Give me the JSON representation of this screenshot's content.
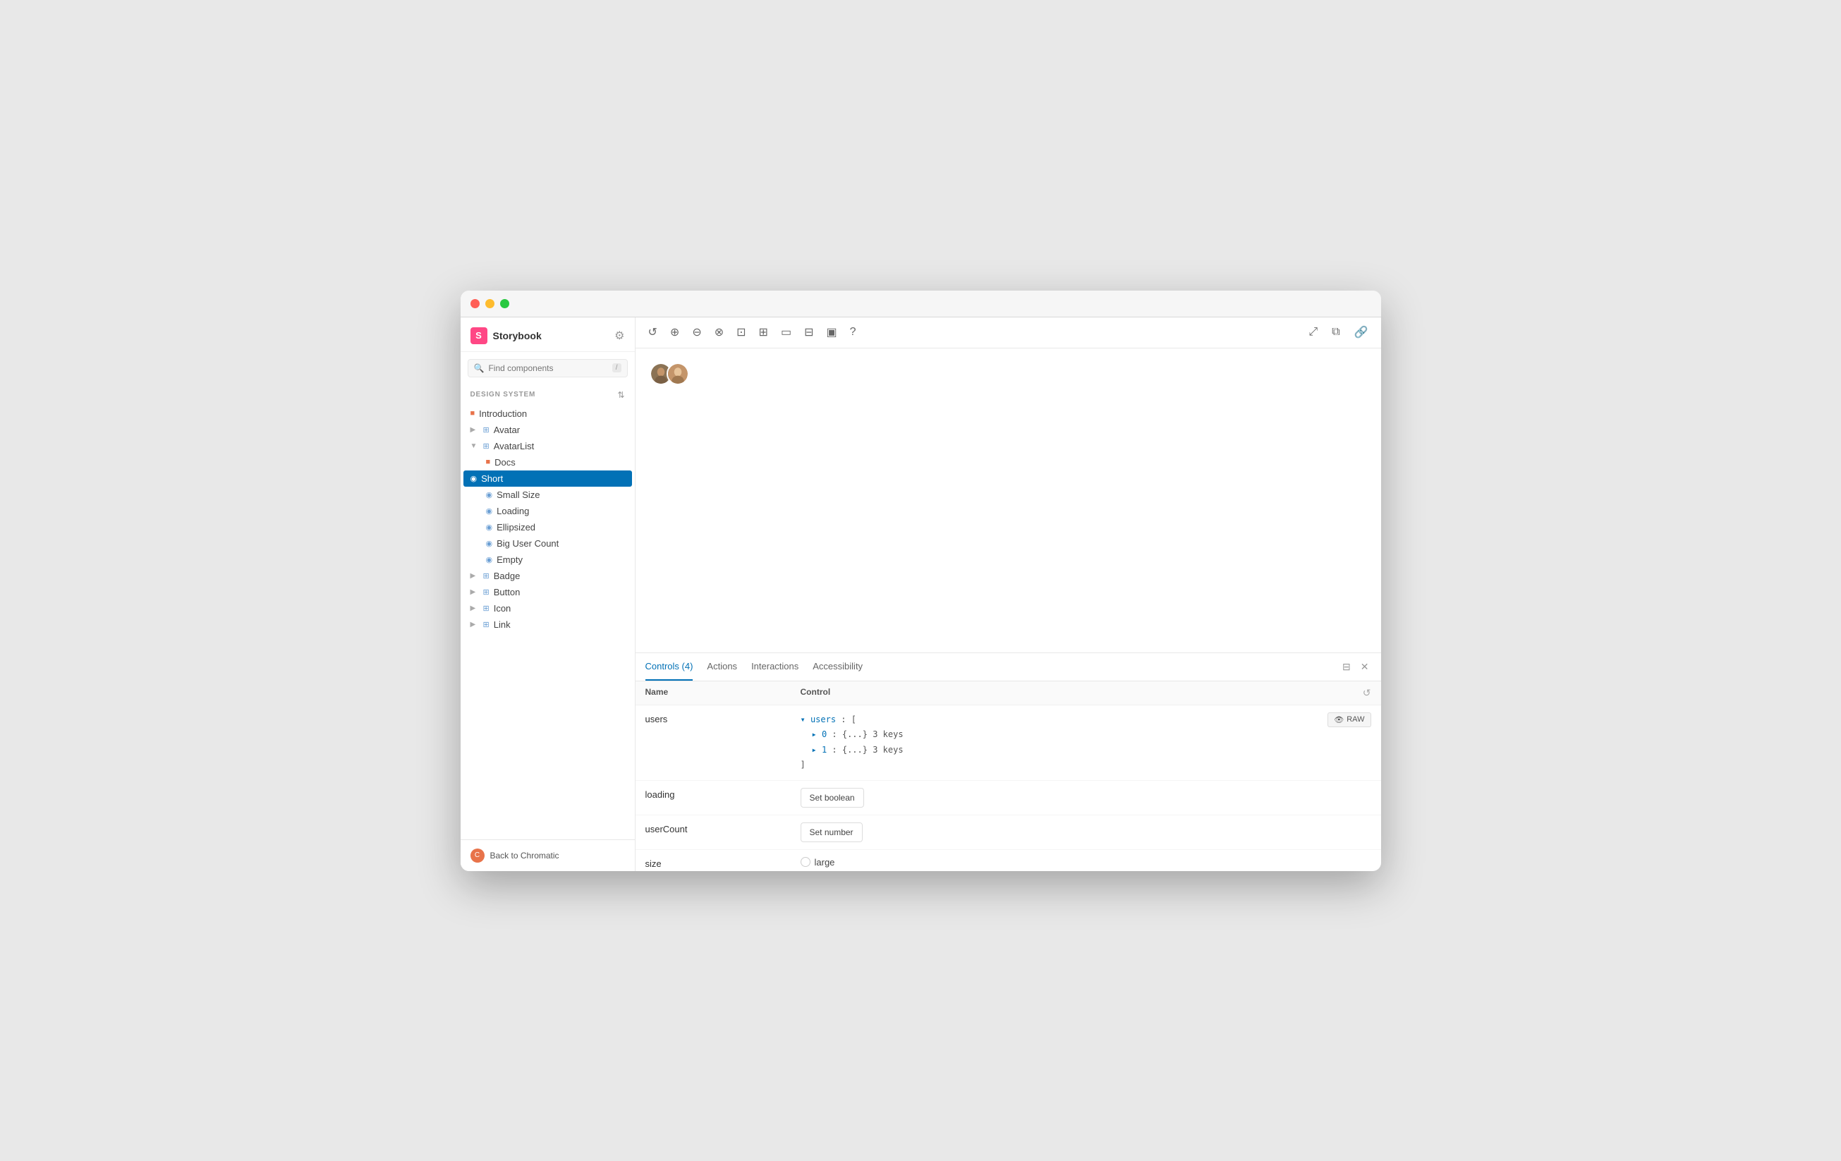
{
  "window": {
    "title": "Storybook"
  },
  "sidebar": {
    "logo": "S",
    "app_name": "Storybook",
    "search_placeholder": "Find components",
    "search_shortcut": "/",
    "section_title": "DESIGN SYSTEM",
    "nav_items": [
      {
        "id": "introduction",
        "label": "Introduction",
        "icon": "doc",
        "indent": 0,
        "type": "doc"
      },
      {
        "id": "avatar",
        "label": "Avatar",
        "icon": "component",
        "indent": 0,
        "type": "component",
        "expanded": false
      },
      {
        "id": "avatarlist",
        "label": "AvatarList",
        "icon": "component",
        "indent": 0,
        "type": "component",
        "expanded": true
      },
      {
        "id": "avatarlist-docs",
        "label": "Docs",
        "icon": "doc",
        "indent": 1,
        "type": "doc"
      },
      {
        "id": "avatarlist-short",
        "label": "Short",
        "icon": "story",
        "indent": 1,
        "type": "story",
        "active": true
      },
      {
        "id": "avatarlist-smallsize",
        "label": "Small Size",
        "icon": "story",
        "indent": 1,
        "type": "story"
      },
      {
        "id": "avatarlist-loading",
        "label": "Loading",
        "icon": "story",
        "indent": 1,
        "type": "story"
      },
      {
        "id": "avatarlist-ellipsized",
        "label": "Ellipsized",
        "icon": "story",
        "indent": 1,
        "type": "story"
      },
      {
        "id": "avatarlist-bigusercount",
        "label": "Big User Count",
        "icon": "story",
        "indent": 1,
        "type": "story"
      },
      {
        "id": "avatarlist-empty",
        "label": "Empty",
        "icon": "story",
        "indent": 1,
        "type": "story"
      },
      {
        "id": "badge",
        "label": "Badge",
        "icon": "component",
        "indent": 0,
        "type": "component",
        "expanded": false
      },
      {
        "id": "button",
        "label": "Button",
        "icon": "component",
        "indent": 0,
        "type": "component",
        "expanded": false
      },
      {
        "id": "icon",
        "label": "Icon",
        "icon": "component",
        "indent": 0,
        "type": "component",
        "expanded": false
      },
      {
        "id": "link",
        "label": "Link",
        "icon": "component",
        "indent": 0,
        "type": "component",
        "expanded": false
      }
    ],
    "back_label": "Back to Chromatic"
  },
  "toolbar": {
    "left_tools": [
      "refresh",
      "zoom-in",
      "zoom-out",
      "zoom-reset",
      "grid-single",
      "grid-multi",
      "layout-side",
      "layout-bottom",
      "layout-both",
      "help"
    ],
    "right_tools": [
      "expand",
      "new-window",
      "link"
    ]
  },
  "controls_panel": {
    "tabs": [
      {
        "id": "controls",
        "label": "Controls (4)",
        "active": true
      },
      {
        "id": "actions",
        "label": "Actions",
        "active": false
      },
      {
        "id": "interactions",
        "label": "Interactions",
        "active": false
      },
      {
        "id": "accessibility",
        "label": "Accessibility",
        "active": false
      }
    ],
    "columns": {
      "name": "Name",
      "control": "Control"
    },
    "rows": [
      {
        "id": "users",
        "name": "users",
        "type": "object",
        "value_display": "▾ users : [\n  ▸ 0 : {...} 3 keys\n  ▸ 1 : {...} 3 keys\n]",
        "action_label": "RAW"
      },
      {
        "id": "loading",
        "name": "loading",
        "type": "boolean",
        "button_label": "Set boolean"
      },
      {
        "id": "userCount",
        "name": "userCount",
        "type": "number",
        "button_label": "Set number"
      },
      {
        "id": "size",
        "name": "size",
        "type": "radio",
        "option_label": "large"
      }
    ]
  }
}
